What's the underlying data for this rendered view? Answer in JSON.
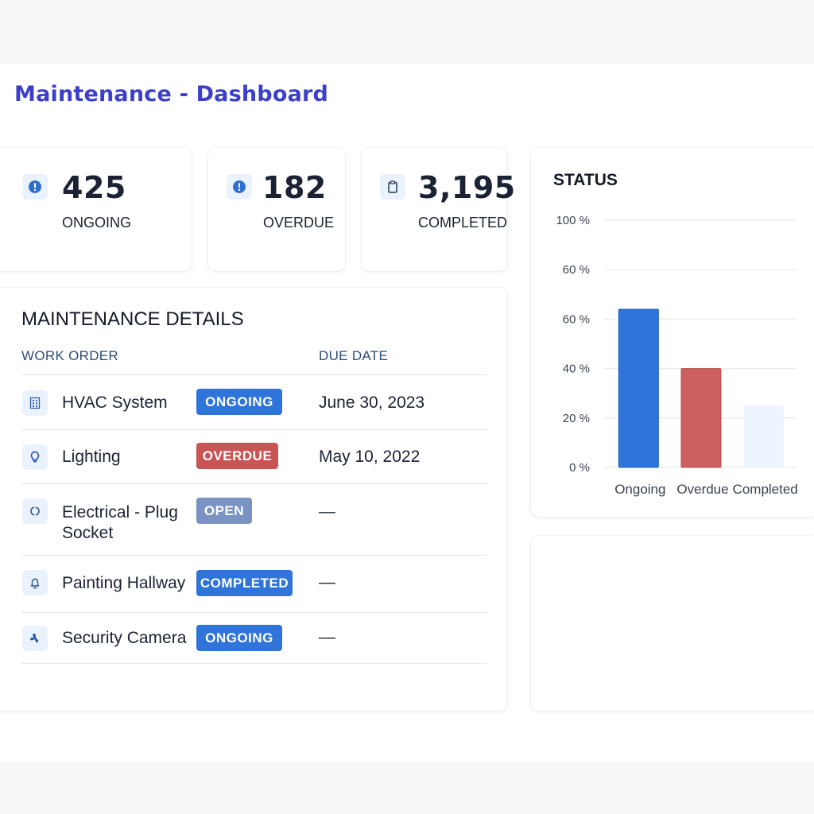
{
  "title": "Maintenance - Dashboard",
  "stats": [
    {
      "value": "425",
      "label": "ONGOING",
      "icon": "alert-circle-icon"
    },
    {
      "value": "182",
      "label": "OVERDUE",
      "icon": "alert-circle-icon"
    },
    {
      "value": "3,195",
      "label": "COMPLETED",
      "icon": "clipboard-icon"
    }
  ],
  "details": {
    "title": "MAINTENANCE DETAILS",
    "col_work_order": "WORK ORDER",
    "col_due_date": "DUE DATE",
    "rows": [
      {
        "name": "HVAC System",
        "status": "ONGOING",
        "status_color": "#2f74d8",
        "due": "June 30, 2023",
        "icon": "building-icon"
      },
      {
        "name": "Lighting",
        "status": "OVERDUE",
        "status_color": "#c85454",
        "due": "May 10, 2022",
        "icon": "lightbulb-icon"
      },
      {
        "name": "Electrical - Plug Socket",
        "status": "OPEN",
        "status_color": "#7a93c2",
        "due": "—",
        "icon": "plug-icon"
      },
      {
        "name": "Painting Hallway",
        "status": "COMPLETED",
        "status_color": "#2f74d8",
        "due": "—",
        "icon": "bell-icon"
      },
      {
        "name": "Security Camera",
        "status": "ONGOING",
        "status_color": "#2f74d8",
        "due": "—",
        "icon": "fan-icon"
      }
    ]
  },
  "chart_data": {
    "type": "bar",
    "title": "STATUS",
    "categories": [
      "Ongoing",
      "Overdue",
      "Completed"
    ],
    "values": [
      64,
      40,
      25
    ],
    "colors": [
      "#2f74d8",
      "#cc5f5f",
      "#eef4fd"
    ],
    "ylim": [
      0,
      100
    ],
    "yticks": [
      {
        "value": 0,
        "label": "0 %"
      },
      {
        "value": 20,
        "label": "20 %"
      },
      {
        "value": 40,
        "label": "40 %"
      },
      {
        "value": 60,
        "label": "60 %"
      },
      {
        "value": 80,
        "label": "60 %"
      },
      {
        "value": 100,
        "label": "100 %"
      }
    ],
    "grid": true
  }
}
